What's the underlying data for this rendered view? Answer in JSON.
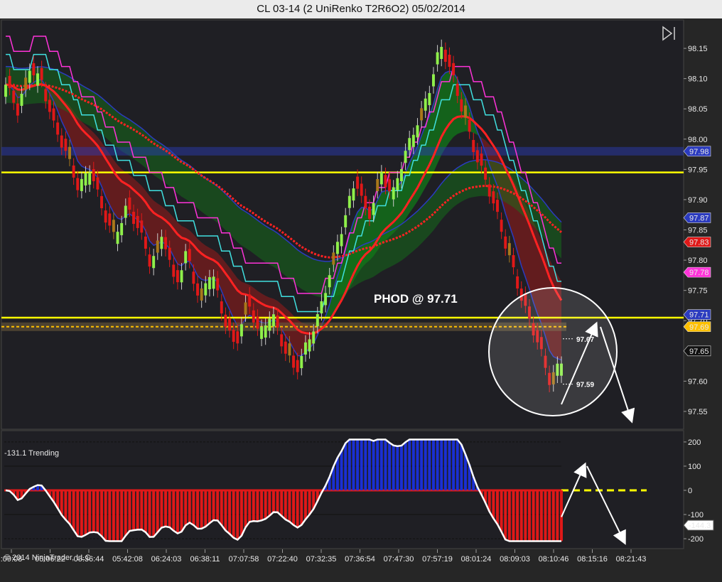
{
  "window": {
    "title": "CL 03-14 (2 UniRenko T2R6O2)  05/02/2014"
  },
  "copyright": "© 2014 NinjaTrader, LLC",
  "colors": {
    "background": "#1f1f24",
    "bull": "#8ff04a",
    "bear": "#e01818",
    "neutral": "#a9781a",
    "hod_line": "#ffff00",
    "cloud_green": "#117a18",
    "cloud_red": "#7a1c1c",
    "sma_red": "#ff2222",
    "cyan_band": "#40e0e0",
    "magenta_band": "#ff33d9"
  },
  "chart_data": [
    {
      "type": "candlestick",
      "title": "",
      "price_axis": {
        "ylim": [
          97.53,
          98.19
        ],
        "ticks": [
          "98.15",
          "98.10",
          "98.05",
          "98.00",
          "97.95",
          "97.90",
          "97.85",
          "97.80",
          "97.75",
          "97.70",
          "97.65",
          "97.60",
          "97.55"
        ]
      },
      "time_axis_labels": [
        ":09:08",
        "05:06:22",
        "05:36:44",
        "05:42:08",
        "06:24:03",
        "06:38:11",
        "07:07:58",
        "07:22:40",
        "07:32:35",
        "07:36:54",
        "07:47:30",
        "07:57:19",
        "08:01:24",
        "08:09:03",
        "08:10:46",
        "08:15:16",
        "08:21:43"
      ],
      "close_path": [
        98.09,
        98.04,
        98.12,
        98.1,
        98.02,
        97.97,
        97.92,
        97.96,
        97.88,
        97.83,
        97.89,
        97.86,
        97.79,
        97.84,
        97.76,
        97.82,
        97.73,
        97.78,
        97.71,
        97.66,
        97.73,
        97.67,
        97.72,
        97.66,
        97.61,
        97.66,
        97.72,
        97.8,
        97.86,
        97.93,
        97.87,
        97.95,
        97.9,
        97.97,
        98.03,
        98.08,
        98.15,
        98.1,
        98.04,
        97.97,
        97.91,
        97.85,
        97.79,
        97.72,
        97.66,
        97.6,
        97.64
      ],
      "price_labels": [
        {
          "label": "97.98",
          "price": 97.98,
          "color": "#2b3bbf"
        },
        {
          "label": "97.87",
          "price": 97.87,
          "color": "#2b3bbf"
        },
        {
          "label": "97.83",
          "price": 97.83,
          "color": "#e01818"
        },
        {
          "label": "97.78",
          "price": 97.78,
          "color": "#ff33d9"
        },
        {
          "label": "97.71",
          "price": 97.71,
          "color": "#2b3bbf"
        },
        {
          "label": "97.69",
          "price": 97.69,
          "color": "#ffc000"
        },
        {
          "label": "97.65",
          "price": 97.65,
          "color": "#111111"
        }
      ],
      "horizontal_lines": [
        {
          "name": "upper-yellow",
          "price": 97.945,
          "color": "#ffff00"
        },
        {
          "name": "phod-yellow",
          "price": 97.705,
          "color": "#ffff00"
        },
        {
          "name": "blue-band",
          "price": 97.98,
          "color": "#2b3bbf"
        }
      ],
      "annotations": [
        {
          "text": "PHOD @ 97.71",
          "price": 97.72
        },
        {
          "text": "97.67",
          "price": 97.67
        },
        {
          "text": "97.59",
          "price": 97.595
        }
      ]
    },
    {
      "type": "histogram",
      "title": "-131.1 Trending",
      "ylim": [
        -235,
        235
      ],
      "ticks": [
        "200",
        "100",
        "0",
        "-100",
        "-200"
      ],
      "last_value_label": "-144.3",
      "last_value": -144.3,
      "levels": [
        200,
        100,
        0,
        -100,
        -200
      ]
    }
  ]
}
